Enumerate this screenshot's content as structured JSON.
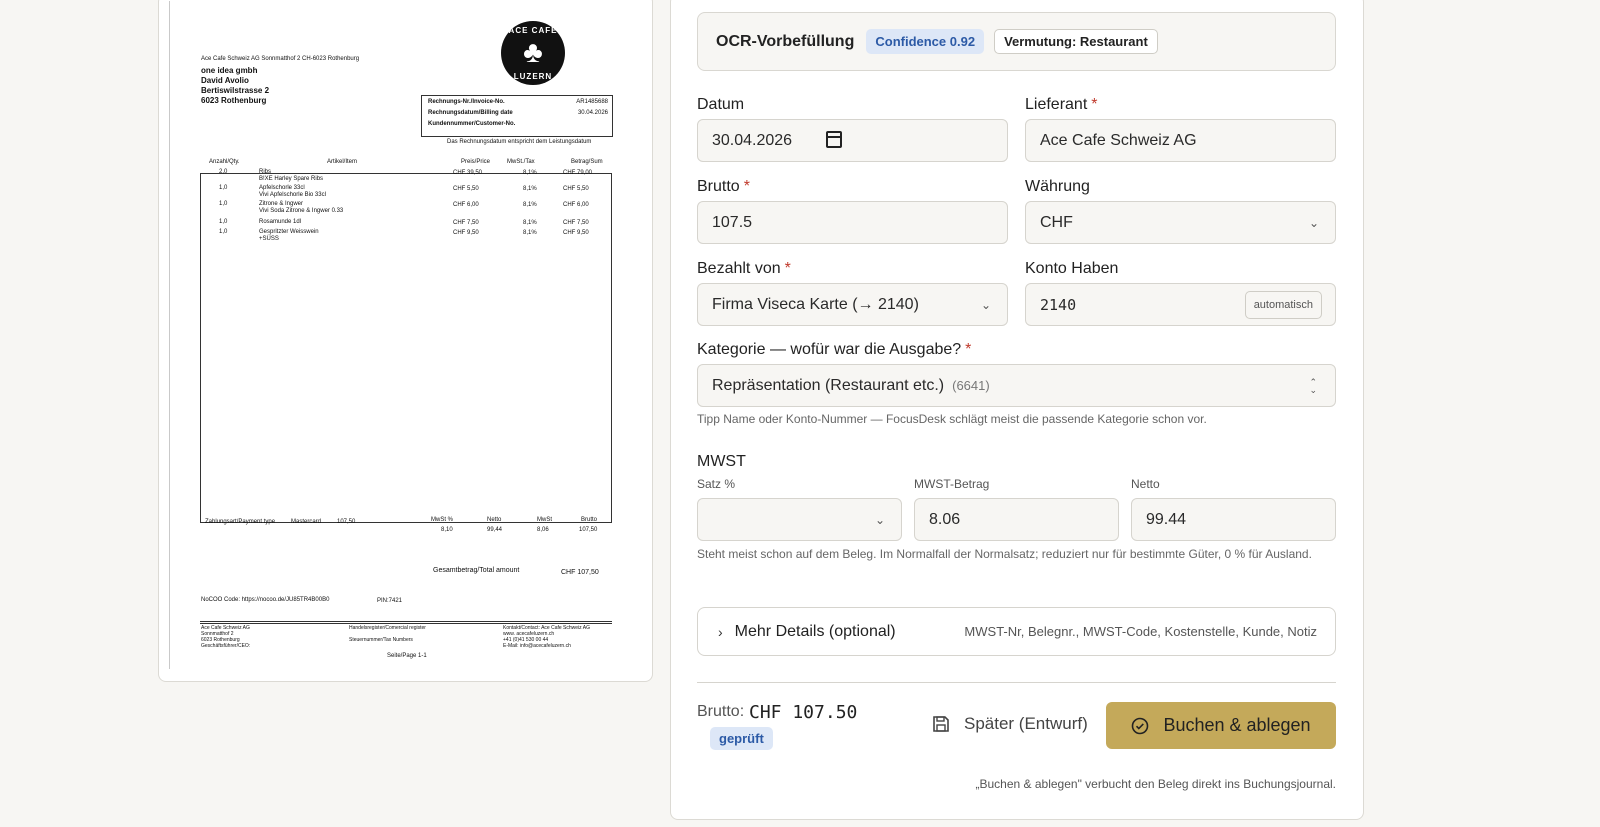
{
  "receipt": {
    "sender_line": "Ace Cafe Schweiz AG Sonnmatthof 2 CH-6023 Rothenburg",
    "recipient": [
      "one idea gmbh",
      "David Avolio",
      "Bertiswilstrasse 2",
      "6023 Rothenburg"
    ],
    "logo_top": "ACE CAFE",
    "logo_bottom": "LUZERN",
    "invoice_labels": [
      "Rechnungs-Nr./Invoice-No.",
      "Rechnungsdatum/Billing date",
      "Kundennummer/Customer-No."
    ],
    "invoice_values": [
      "AR1485688",
      "30.04.2026",
      ""
    ],
    "invoice_note": "Das Rechnungsdatum entspricht dem Leistungsdatum",
    "columns": [
      "Anzahl/Qty.",
      "Artikel/Item",
      "Preis/Price",
      "MwSt./Tax",
      "Betrag/Sum"
    ],
    "items": [
      {
        "qty": "2,0",
        "name": "Ribs",
        "sub": "B!XE Harley Spare Ribs",
        "price": "CHF 39,50",
        "tax": "8,1%",
        "sum": "CHF 79,00"
      },
      {
        "qty": "1,0",
        "name": "Apfelschorle 33cl",
        "sub": "Vivi Apfelschorle Bio 33cl",
        "price": "CHF 5,50",
        "tax": "8,1%",
        "sum": "CHF 5,50"
      },
      {
        "qty": "1,0",
        "name": "Zitrone & Ingwer",
        "sub": "Vivi Soda Zitrone & Ingwer 0.33",
        "price": "CHF 6,00",
        "tax": "8,1%",
        "sum": "CHF 6,00"
      },
      {
        "qty": "1,0",
        "name": "Rosamunde 1dl",
        "sub": "",
        "price": "CHF 7,50",
        "tax": "8,1%",
        "sum": "CHF 7,50"
      },
      {
        "qty": "1,0",
        "name": "Gespritzter Weisswein",
        "sub": "+SÜSS",
        "price": "CHF 9,50",
        "tax": "8,1%",
        "sum": "CHF 9,50"
      }
    ],
    "payment_label": "Zahlungsart/Payment type",
    "payment_method": "Mastercard",
    "payment_amount": "107,50",
    "tax_headers": [
      "MwSt %",
      "Netto",
      "MwSt",
      "Brutto"
    ],
    "tax_values": [
      "8,10",
      "99,44",
      "8,06",
      "107,50"
    ],
    "total_label": "Gesamtbetrag/Total amount",
    "total_value": "CHF 107,50",
    "nocoo": "NoCOO Code: https://nocoo.de/JU85TR4B00B0",
    "pin": "PIN:7421",
    "footer_left": [
      "Ace Cafe Schweiz AG",
      "Sonnmatthof 2",
      "6023 Rothenburg",
      "Geschäftsführer/CEO:"
    ],
    "footer_mid": [
      "Handelsregister/Comercial register",
      "Steuernummer/Tax Numbers"
    ],
    "footer_right": [
      "Kontakt/Contact: Ace Cafe Schweiz AG",
      "www. acecafeluzern.ch",
      "+41 (0)41 530 00 44",
      "E-Mail: info@acecafeluzern.ch"
    ],
    "page": "Seite/Page 1-1"
  },
  "ocr": {
    "title": "OCR-Vorbefüllung",
    "confidence": "Confidence 0.92",
    "guess": "Vermutung: Restaurant"
  },
  "form": {
    "datum_label": "Datum",
    "datum_value": "30.04.2026",
    "lieferant_label": "Lieferant",
    "lieferant_value": "Ace Cafe Schweiz AG",
    "brutto_label": "Brutto",
    "brutto_value": "107.5",
    "waehrung_label": "Währung",
    "waehrung_value": "CHF",
    "bezahlt_label": "Bezahlt von",
    "bezahlt_value": "Firma Viseca Karte (→ 2140)",
    "konto_label": "Konto Haben",
    "konto_value": "2140",
    "konto_tag": "automatisch",
    "kategorie_label": "Kategorie — wofür war die Ausgabe?",
    "kategorie_value": "Repräsentation (Restaurant etc.)",
    "kategorie_code": "(6641)",
    "kategorie_hint": "Tipp Name oder Konto-Nummer — FocusDesk schlägt meist die passende Kategorie schon vor.",
    "required_mark": "*"
  },
  "mwst": {
    "title": "MWST",
    "satz_label": "Satz %",
    "satz_value": "",
    "betrag_label": "MWST-Betrag",
    "betrag_value": "8.06",
    "netto_label": "Netto",
    "netto_value": "99.44",
    "hint": "Steht meist schon auf dem Beleg. Im Normalfall der Normalsatz; reduziert nur für bestimmte Güter, 0 % für Ausland."
  },
  "details": {
    "title": "Mehr Details (optional)",
    "summary": "MWST-Nr, Belegnr., MWST-Code, Kostenstelle, Kunde, Notiz"
  },
  "footer": {
    "brutto_label": "Brutto:",
    "brutto_value": "CHF 107.50",
    "checked_badge": "geprüft",
    "draft_button": "Später (Entwurf)",
    "book_button": "Buchen & ablegen",
    "note": "„Buchen & ablegen\" verbucht den Beleg direkt ins Buchungsjournal."
  },
  "colors": {
    "accent": "#c4a95a",
    "badge_blue_bg": "#dde7f7",
    "badge_blue_text": "#2c5aa6",
    "required": "#c0392b"
  }
}
